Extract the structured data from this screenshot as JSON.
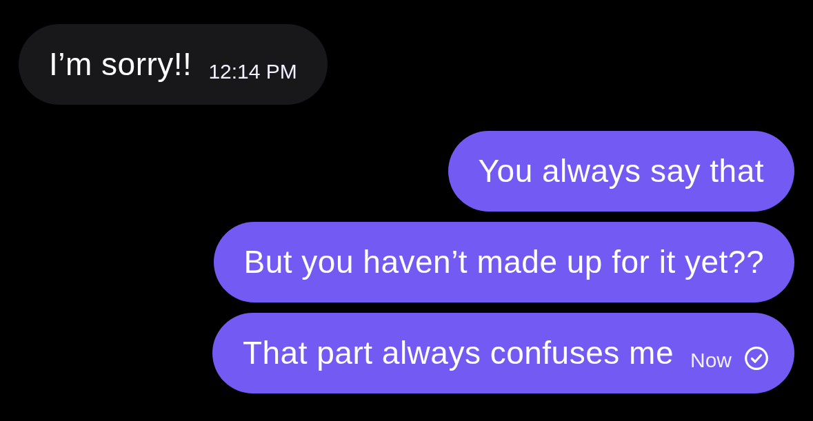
{
  "messages": [
    {
      "kind": "incoming",
      "text": "I’m sorry!!",
      "time": "12:14 PM"
    },
    {
      "kind": "outgoing",
      "text": "You always say that"
    },
    {
      "kind": "outgoing",
      "text": "But you haven’t made up for it yet??"
    },
    {
      "kind": "outgoing",
      "text": "That part always confuses me",
      "time": "Now",
      "delivered": true
    }
  ]
}
